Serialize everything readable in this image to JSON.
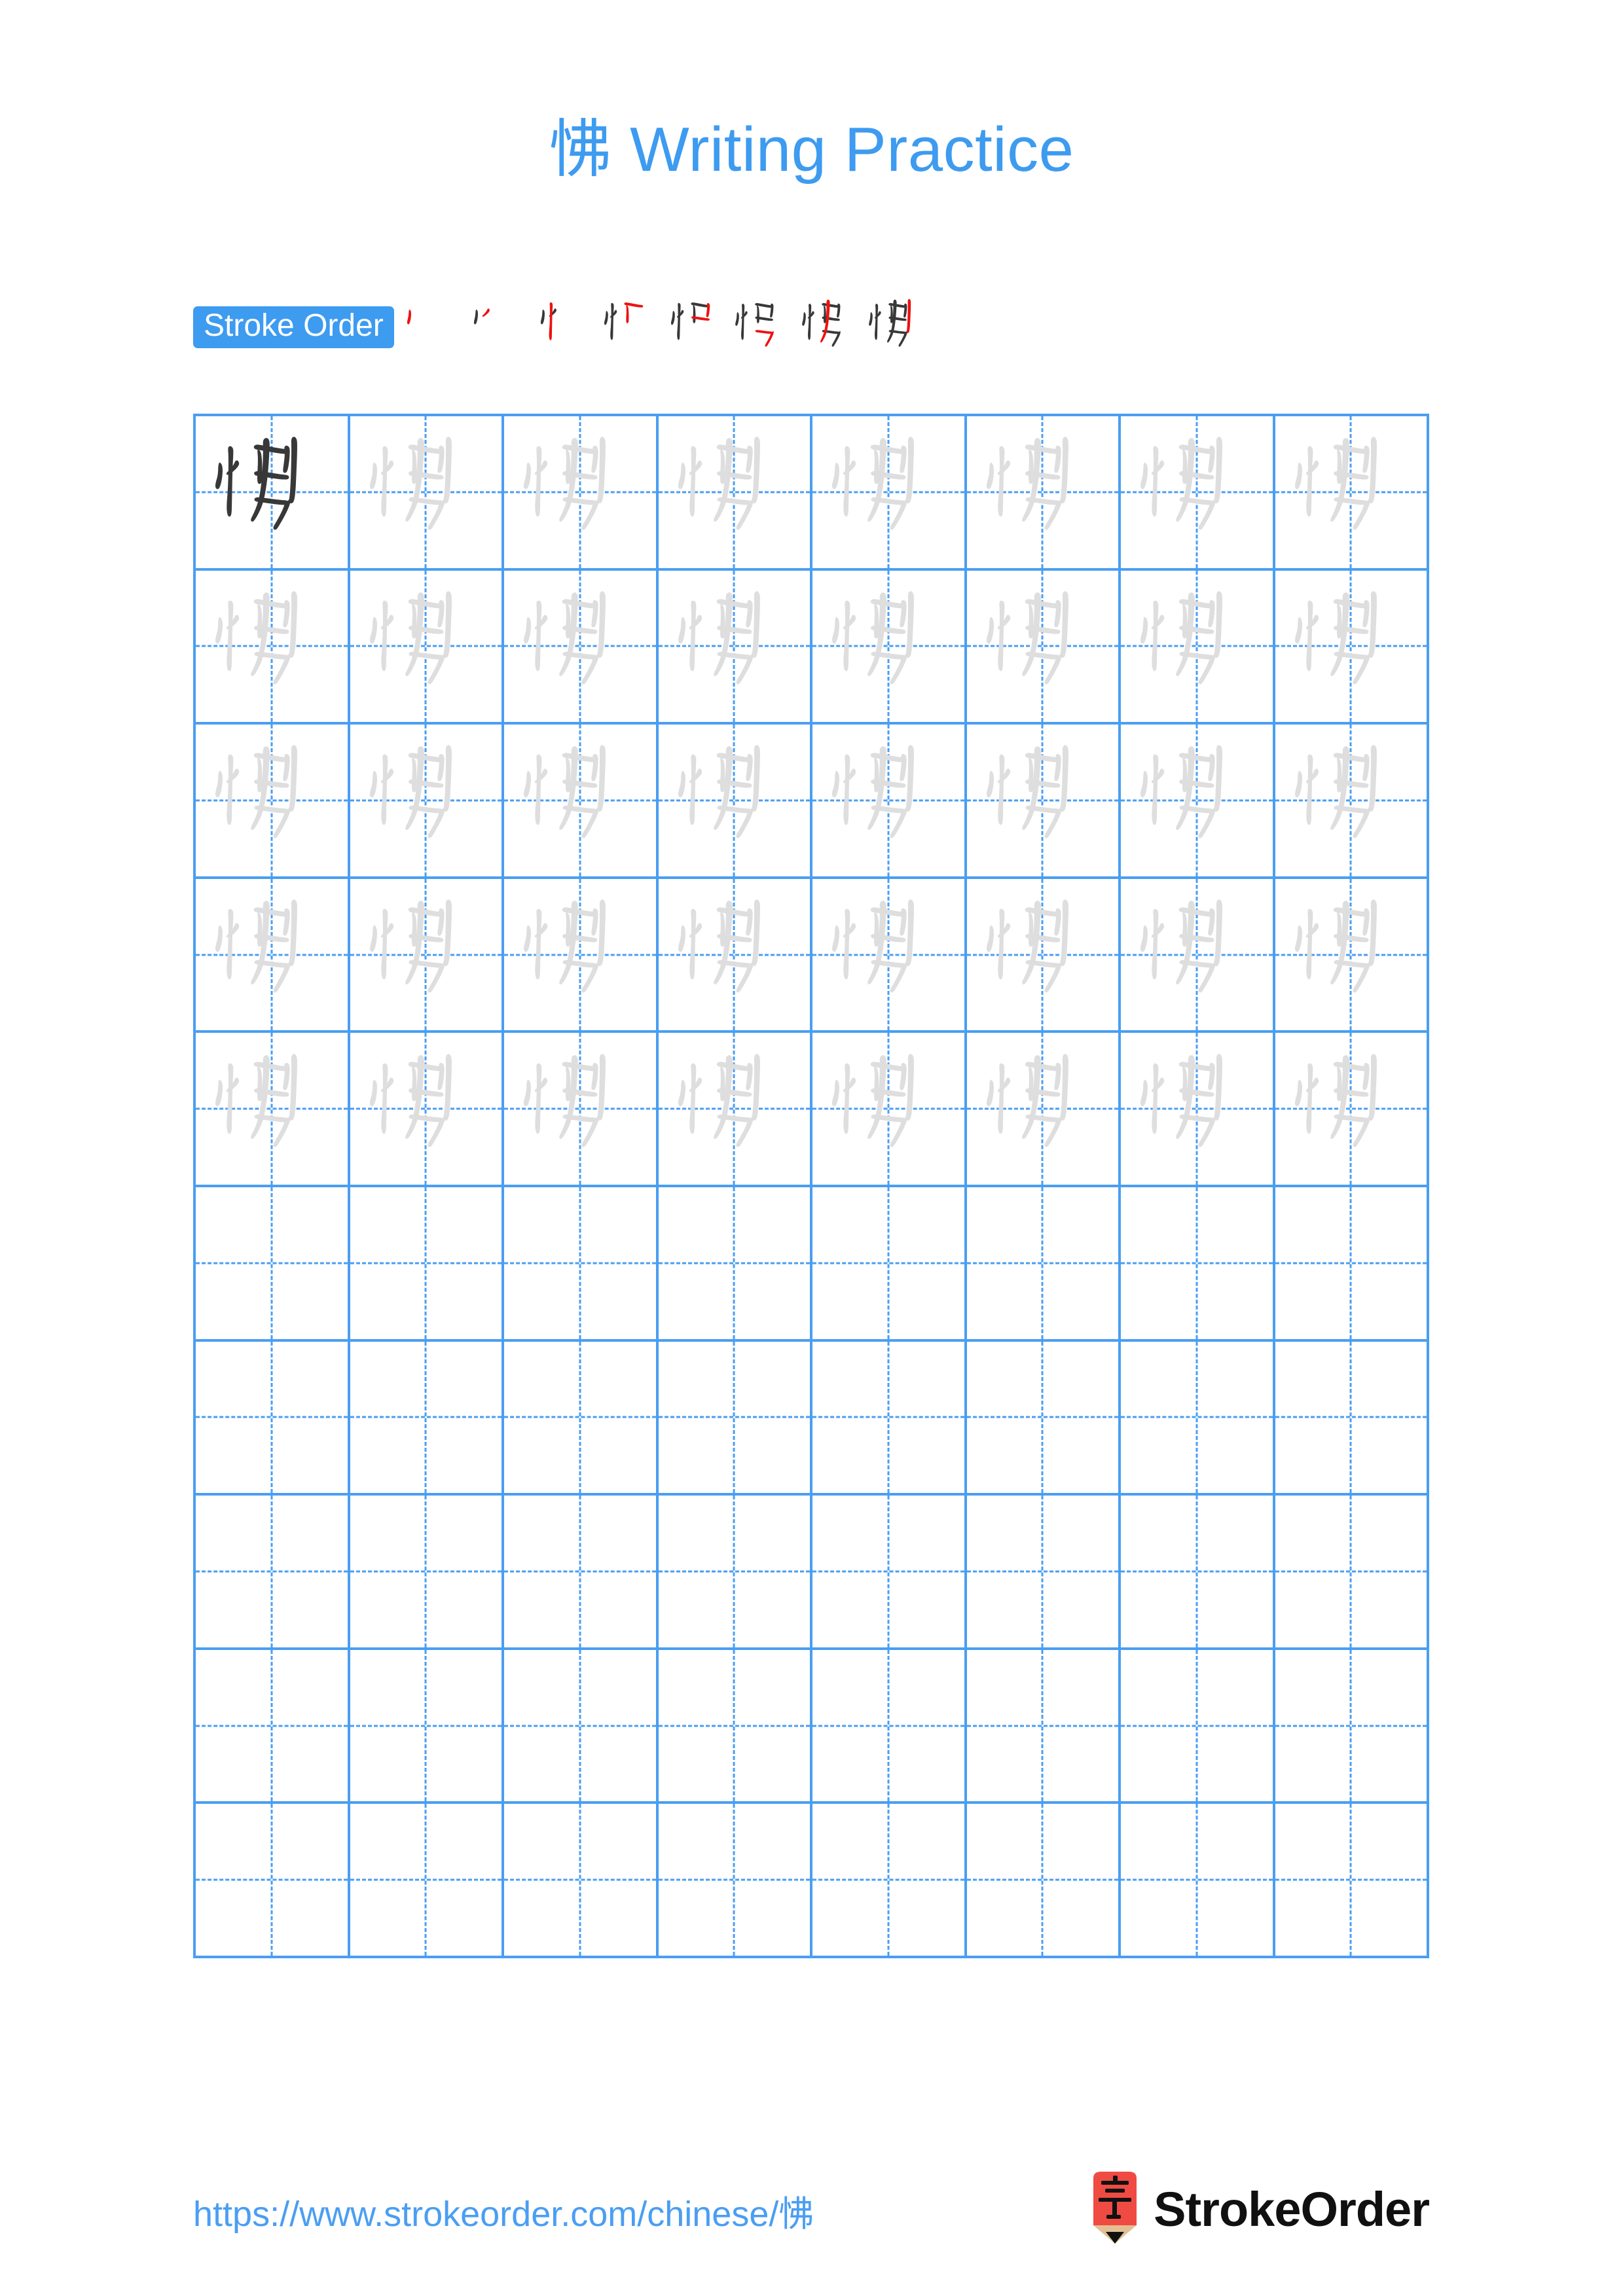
{
  "character": "怫",
  "title": "怫 Writing Practice",
  "colors": {
    "accent_blue": "#3d9bf0",
    "grid_blue": "#4a9ef2",
    "stroke_highlight_red": "#ee1111",
    "stroke_ink_dark": "#383838",
    "trace_gray": "#dedede",
    "logo_red": "#ef4b43",
    "logo_wood": "#e3c093"
  },
  "stroke_order": {
    "badge_label": "Stroke Order",
    "total_strokes": 8,
    "steps": [
      {
        "index": 1,
        "cumulative": 1,
        "new_stroke": 1
      },
      {
        "index": 2,
        "cumulative": 2,
        "new_stroke": 2
      },
      {
        "index": 3,
        "cumulative": 3,
        "new_stroke": 3
      },
      {
        "index": 4,
        "cumulative": 4,
        "new_stroke": 4
      },
      {
        "index": 5,
        "cumulative": 5,
        "new_stroke": 5
      },
      {
        "index": 6,
        "cumulative": 6,
        "new_stroke": 6
      },
      {
        "index": 7,
        "cumulative": 7,
        "new_stroke": 7
      },
      {
        "index": 8,
        "cumulative": 8,
        "new_stroke": 8
      }
    ]
  },
  "grid": {
    "columns": 8,
    "rows": 10,
    "filled_rows": 5,
    "empty_rows": 5,
    "first_cell_style": "dark",
    "trace_cell_style": "light"
  },
  "footer": {
    "url": "https://www.strokeorder.com/chinese/怫",
    "brand": "StrokeOrder",
    "logo_glyph": "字"
  }
}
